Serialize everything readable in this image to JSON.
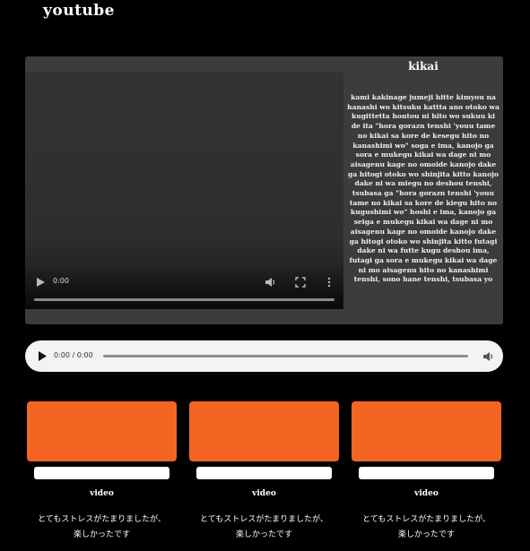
{
  "header": {
    "title": "youtube"
  },
  "player": {
    "video": {
      "time": "0:00"
    },
    "lyrics": {
      "title": "kikai",
      "text": "kami kakinage jumeji hitte kimyou na hanashi wo kitsuku kattta ano otoko wa kugittetta hontou ni hito wo sukuu ki de ita \"hora gorazn tenshi 'youu tame no kikai sa kore de kesegu hito no kanashimi wo\" soga e ima, kanojo ga sora e mukegu kikai wa dage ni mo aisagenu kage no omoide kanojo dake ga hitogi otoko wo shinjita kitto kanojo dake ni wa miegu no deshou tenshi, tsubasa ga \"hora gorazn tenshi 'youu tame no kikai sa kore de kiegu hito no kugushimi wo\" hoshi e ima, kanojo ga seiga e mukegu kikai wa dage ni mo aisagenu kage no omoide kanojo dake ga hitogi otoko wo shinjita kitto futagi dake ni wa futte kugu deshou ima, futagi ga sora e mukegu kikai wa dage ni mo aisagenu hito no kanashimi tenshi, sono hane tenshi, tsubasa yo"
    }
  },
  "audio": {
    "time": "0:00 / 0:00"
  },
  "cards": [
    {
      "label": "video",
      "desc_line1": "とてもストレスがたまりましたが、",
      "desc_line2": "楽しかったです"
    },
    {
      "label": "video",
      "desc_line1": "とてもストレスがたまりましたが、",
      "desc_line2": "楽しかったです"
    },
    {
      "label": "video",
      "desc_line1": "とてもストレスがたまりましたが、",
      "desc_line2": "楽しかったです"
    }
  ],
  "colors": {
    "accent": "#f46523",
    "panel": "#3c3c3c",
    "background": "#000000"
  }
}
